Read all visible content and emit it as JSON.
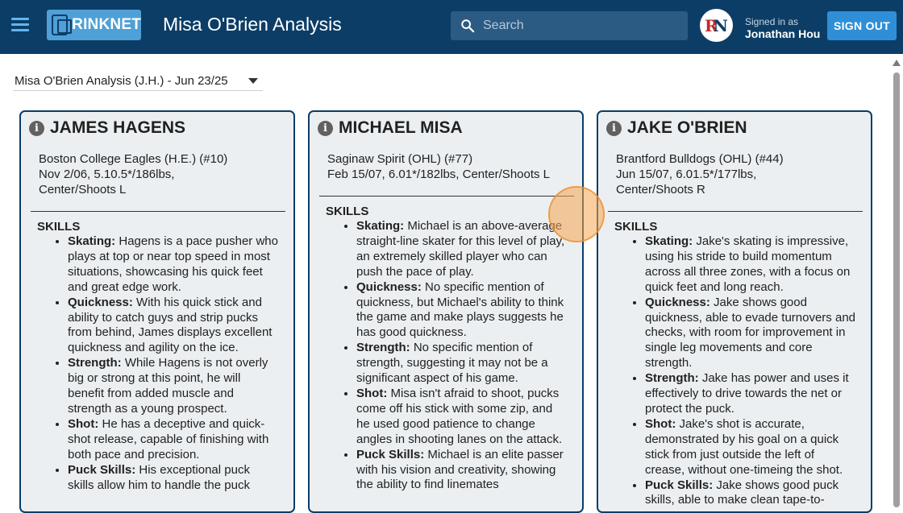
{
  "header": {
    "logo_text": "RINKNET",
    "title": "Misa O'Brien Analysis",
    "search_placeholder": "Search",
    "avatar_text": "R",
    "avatar_text2": "N",
    "signed_in_label": "Signed in as",
    "user_name": "Jonathan Hou",
    "signout_label": "SIGN OUT"
  },
  "report_select": {
    "value": "Misa O'Brien Analysis (J.H.) - Jun 23/25"
  },
  "cards": [
    {
      "name": "JAMES HAGENS",
      "bio": [
        "Boston College Eagles (H.E.) (#10)",
        "Nov 2/06, 5.10.5*/186lbs,",
        "Center/Shoots L"
      ],
      "skills_title": "SKILLS",
      "skills": [
        {
          "label": "Skating:",
          "text": "Hagens is a pace pusher who plays at top or near top speed in most situations, showcasing his quick feet and great edge work."
        },
        {
          "label": "Quickness:",
          "text": "With his quick stick and ability to catch guys and strip pucks from behind, James displays excellent quickness and agility on the ice."
        },
        {
          "label": "Strength:",
          "text": "While Hagens is not overly big or strong at this point, he will benefit from added muscle and strength as a young prospect."
        },
        {
          "label": "Shot:",
          "text": "He has a deceptive and quick-shot release, capable of finishing with both pace and precision."
        },
        {
          "label": "Puck Skills:",
          "text": "His exceptional puck skills allow him to handle the puck"
        }
      ]
    },
    {
      "name": "MICHAEL MISA",
      "bio": [
        "Saginaw Spirit (OHL) (#77)",
        "Feb 15/07, 6.01*/182lbs, Center/Shoots L"
      ],
      "skills_title": "SKILLS",
      "skills": [
        {
          "label": "Skating:",
          "text": "Michael is an above-average straight-line skater for this level of play, an extremely skilled player who can push the pace of play."
        },
        {
          "label": "Quickness:",
          "text": "No specific mention of quickness, but Michael's ability to think the game and make plays suggests he has good quickness."
        },
        {
          "label": "Strength:",
          "text": "No specific mention of strength, suggesting it may not be a significant aspect of his game."
        },
        {
          "label": "Shot:",
          "text": "Misa isn't afraid to shoot, pucks come off his stick with some zip, and he used good patience to change angles in shooting lanes on the attack."
        },
        {
          "label": "Puck Skills:",
          "text": "Michael is an elite passer with his vision and creativity, showing the ability to find linemates"
        }
      ]
    },
    {
      "name": "JAKE O'BRIEN",
      "bio": [
        "Brantford Bulldogs (OHL) (#44)",
        "Jun 15/07, 6.01.5*/177lbs,",
        "Center/Shoots R"
      ],
      "skills_title": "SKILLS",
      "skills": [
        {
          "label": "Skating:",
          "text": "Jake's skating is impressive, using his stride to build momentum across all three zones, with a focus on quick feet and long reach."
        },
        {
          "label": "Quickness:",
          "text": "Jake shows good quickness, able to evade turnovers and checks, with room for improvement in single leg movements and core strength."
        },
        {
          "label": "Strength:",
          "text": "Jake has power and uses it effectively to drive towards the net or protect the puck."
        },
        {
          "label": "Shot:",
          "text": "Jake's shot is accurate, demonstrated by his goal on a quick stick from just outside the left of crease, without one-timeing the shot."
        },
        {
          "label": "Puck Skills:",
          "text": "Jake shows good puck skills, able to make clean tape-to-"
        }
      ]
    }
  ],
  "colors": {
    "appbar": "#0c3d66",
    "accent": "#2f8fd6",
    "card_bg": "#eceff1",
    "card_border": "#0c3d66"
  }
}
